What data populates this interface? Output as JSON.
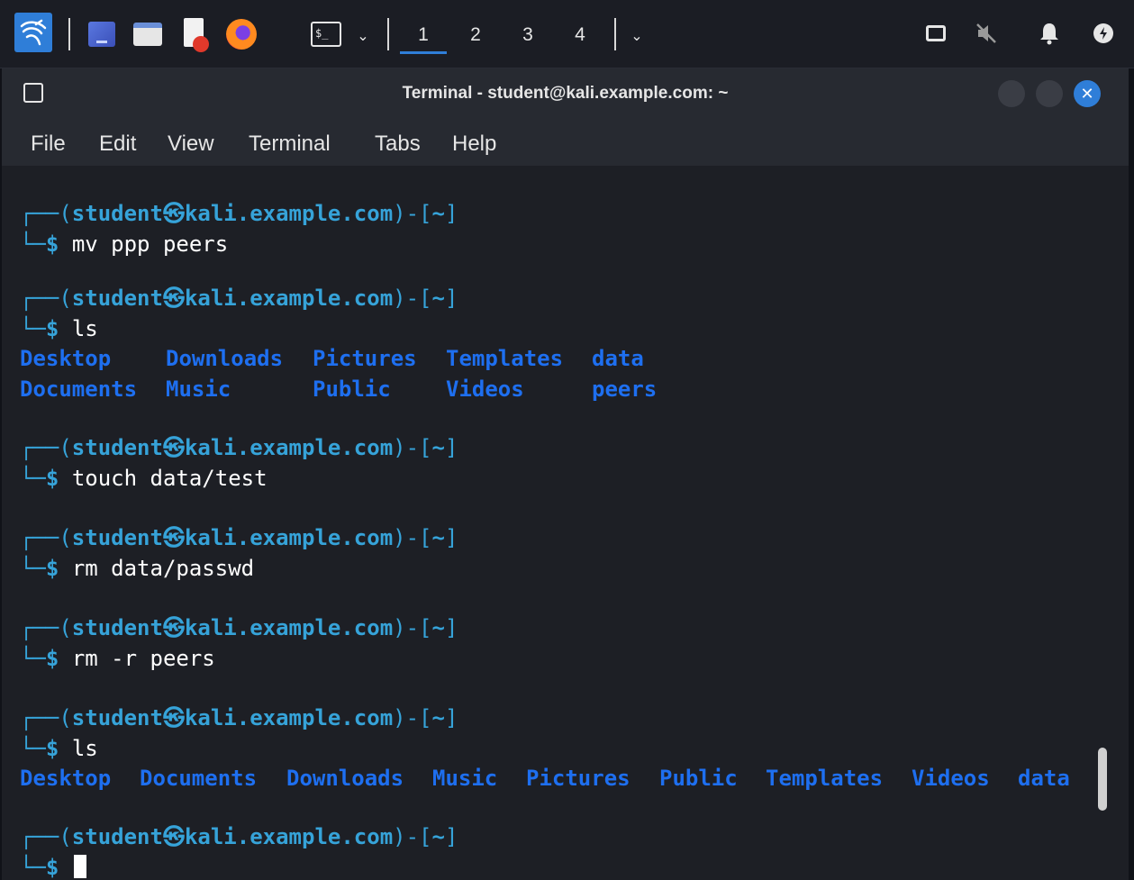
{
  "panel": {
    "workspaces": [
      "1",
      "2",
      "3",
      "4"
    ],
    "active_workspace": "1"
  },
  "window": {
    "title": "Terminal - student@kali.example.com: ~",
    "menu": [
      "File",
      "Edit",
      "View",
      "Terminal",
      "Tabs",
      "Help"
    ]
  },
  "prompt": {
    "frame_top": "┌──(",
    "user": "student",
    "at": "㉿",
    "host": "kali.example.com",
    "close": ")-[",
    "path": "~",
    "end": "]",
    "frame_bottom": "└─",
    "symbol": "$"
  },
  "terminal": {
    "cmd1": "mv ppp peers",
    "cmd2": "ls",
    "ls1_row1": [
      "Desktop",
      "Downloads",
      "Pictures",
      "Templates",
      "data"
    ],
    "ls1_row2": [
      "Documents",
      "Music",
      "Public",
      "Videos",
      "peers"
    ],
    "cmd3": "touch data/test",
    "cmd4": "rm data/passwd",
    "cmd5": "rm -r peers",
    "cmd6": "ls",
    "ls2_row": [
      "Desktop",
      "Documents",
      "Downloads",
      "Music",
      "Pictures",
      "Public",
      "Templates",
      "Videos",
      "data"
    ]
  },
  "colors": {
    "prompt": "#36a3d9",
    "directory": "#1e6ff0",
    "background": "#1d1f25"
  }
}
